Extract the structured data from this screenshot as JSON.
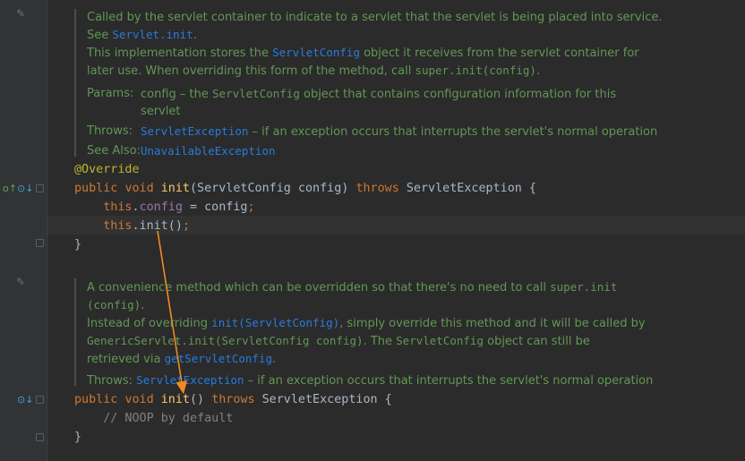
{
  "doc1": {
    "line1": "Called by the servlet container to indicate to a servlet that the servlet is being placed into service.",
    "see_prefix": "See ",
    "see_link": "Servlet.init",
    "see_suffix": ".",
    "impl_a": "This implementation stores the ",
    "impl_link": "ServletConfig",
    "impl_b": " object it receives from the servlet container for",
    "impl_c": "later use. When overriding this form of the method, call ",
    "impl_code": "super.init(config)",
    "impl_d": ".",
    "params_label": "Params:",
    "params_a": "config – the ",
    "params_code": "ServletConfig",
    "params_b": " object that contains configuration information for this",
    "params_c": "servlet",
    "throws_label": "Throws:",
    "throws_link": "ServletException",
    "throws_text": " – if an exception occurs that interrupts the servlet's normal operation",
    "seealso_label": "See Also:",
    "seealso_link": "UnavailableException"
  },
  "code1": {
    "annotation": "@Override",
    "kw_public": "public",
    "kw_void": "void",
    "method": "init",
    "params": "(ServletConfig config) ",
    "kw_throws": "throws",
    "exc": " ServletException {",
    "kw_this1": "this",
    "field": "config",
    "assign": " = config",
    "semi": ";",
    "kw_this2": "this",
    "call": ".init()",
    "close": "}"
  },
  "doc2": {
    "a": "A convenience method which can be overridden so that there's no need to call ",
    "code_a": "super.init",
    "code_b": "(config)",
    "b_end": ".",
    "c": "Instead of overriding ",
    "c_link": "init(ServletConfig)",
    "c2": ", simply override this method and it will be called by",
    "d_code": "GenericServlet.init(ServletConfig config)",
    "d2": ". The ",
    "d_code2": "ServletConfig",
    "d3": " object can still be",
    "e": "retrieved via ",
    "e_link": "getServletConfig",
    "e2": ".",
    "throws_label": "Throws: ",
    "throws_link": "ServletException",
    "throws_text": " – if an exception occurs that interrupts the servlet's normal operation"
  },
  "code2": {
    "kw_public": "public",
    "kw_void": "void",
    "method": "init",
    "parens": "() ",
    "kw_throws": "throws",
    "exc": " ServletException {",
    "comment": "// NOOP by default",
    "close": "}"
  },
  "icons": {
    "override": "override-gutter-icon",
    "implemented": "implemented-gutter-icon",
    "edit": "pencil-icon",
    "fold": "fold-marker-icon"
  },
  "colors": {
    "background": "#2b2b2b",
    "doc_text": "#629755",
    "link": "#287bde",
    "keyword": "#cc7832",
    "method": "#ffc66d",
    "field": "#9876aa",
    "annotation": "#bbb529",
    "comment": "#808080",
    "arrow": "#f08a24"
  }
}
